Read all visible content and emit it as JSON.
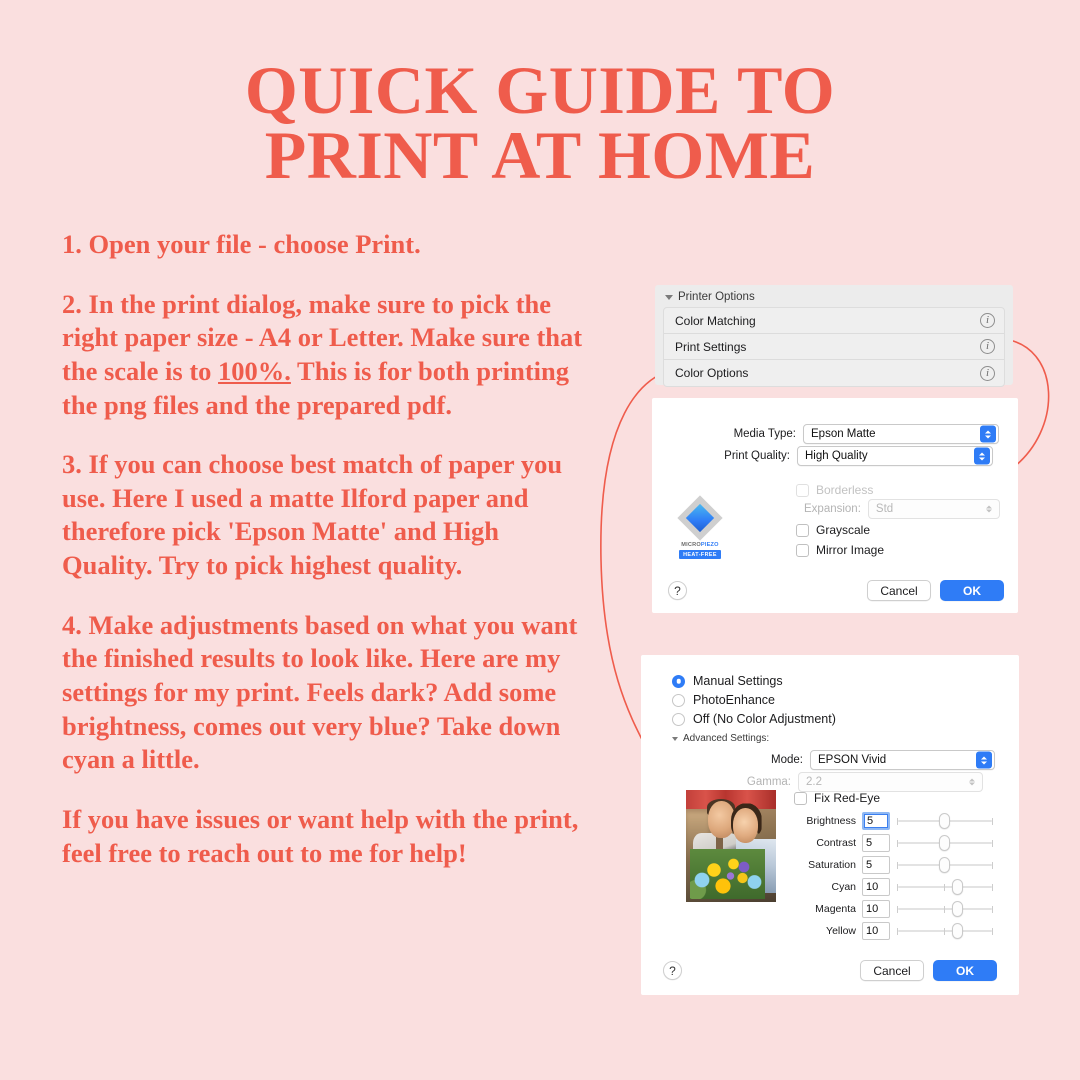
{
  "theme": {
    "background": "#fadfdf",
    "accent": "#ef5c4c",
    "mac_blue": "#2f7cf6"
  },
  "poster": {
    "title_line1": "Quick Guide to",
    "title_line2": "Print at Home",
    "paragraphs": [
      "1. Open your file - choose Print.",
      "2. In the print dialog, make sure to pick the right paper size - A4 or Letter. Make sure that the scale is to ",
      "3. If you can choose best match of paper you use. Here I used a matte Ilford paper and therefore pick 'Epson Matte' and High Quality. Try to pick highest quality.",
      "4. Make adjustments based on what you want the finished results to look like. Here are my settings for my print. Feels dark? Add some brightness, comes out very blue? Take down cyan a little.",
      "If you have issues or want help with the print, feel free to reach out to me for help!"
    ],
    "para2_underlined": "100%.",
    "para2_tail": " This is for both printing the png files and the prepared pdf."
  },
  "printer_options": {
    "header": "Printer Options",
    "rows": [
      {
        "label": "Color Matching",
        "info_icon": "info-circle-icon"
      },
      {
        "label": "Print Settings",
        "info_icon": "info-circle-icon"
      },
      {
        "label": "Color Options",
        "info_icon": "info-circle-icon"
      }
    ]
  },
  "print_settings": {
    "media_type_label": "Media Type:",
    "media_type_value": "Epson Matte",
    "print_quality_label": "Print Quality:",
    "print_quality_value": "High Quality",
    "borderless_label": "Borderless",
    "expansion_label": "Expansion:",
    "expansion_value": "Std",
    "grayscale_label": "Grayscale",
    "mirror_label": "Mirror Image",
    "logo_word_a": "MICRO",
    "logo_word_b": "PIEZO",
    "logo_badge": "HEAT-FREE",
    "help_label": "?",
    "cancel_label": "Cancel",
    "ok_label": "OK"
  },
  "color_options": {
    "radios": [
      {
        "label": "Manual Settings",
        "selected": true
      },
      {
        "label": "PhotoEnhance",
        "selected": false
      },
      {
        "label": "Off (No Color Adjustment)",
        "selected": false
      }
    ],
    "advanced_label": "Advanced Settings:",
    "mode_label": "Mode:",
    "mode_value": "EPSON Vivid",
    "gamma_label": "Gamma:",
    "gamma_value": "2.2",
    "fix_red_eye_label": "Fix Red-Eye",
    "sliders": [
      {
        "name": "Brightness",
        "value": "5",
        "pos": 50,
        "focused": true
      },
      {
        "name": "Contrast",
        "value": "5",
        "pos": 50,
        "focused": false
      },
      {
        "name": "Saturation",
        "value": "5",
        "pos": 50,
        "focused": false
      },
      {
        "name": "Cyan",
        "value": "10",
        "pos": 62,
        "focused": false
      },
      {
        "name": "Magenta",
        "value": "10",
        "pos": 62,
        "focused": false
      },
      {
        "name": "Yellow",
        "value": "10",
        "pos": 62,
        "focused": false
      }
    ],
    "preview_alt": "couple-with-bouquet-photo",
    "help_label": "?",
    "cancel_label": "Cancel",
    "ok_label": "OK"
  }
}
